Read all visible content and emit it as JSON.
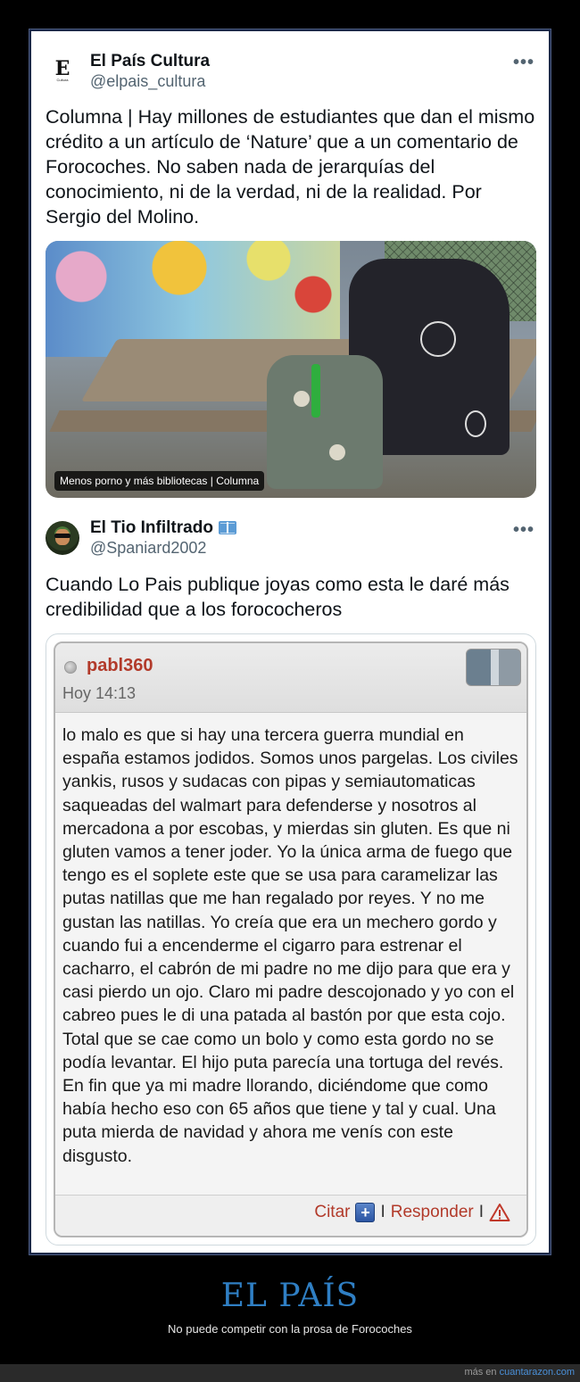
{
  "tweet1": {
    "name": "El País Cultura",
    "handle": "@elpais_cultura",
    "avatar_letter": "E",
    "avatar_sub": "Cultura",
    "more": "•••",
    "text": "Columna | Hay millones de estudiantes que dan el mismo crédito a un artículo de ‘Nature’ que a un comentario de Forocoches. No saben nada de jerarquías del conocimiento, ni de la verdad, ni de la realidad. Por Sergio del Molino.",
    "card_caption": "Menos porno y más bibliotecas | Columna"
  },
  "tweet2": {
    "name": "El Tio Infiltrado",
    "handle": "@Spaniard2002",
    "more": "•••",
    "badge_icon": "book-icon",
    "text": "Cuando Lo Pais publique joyas como esta le daré más credibilidad que a los forococheros"
  },
  "forum_post": {
    "user": "pabl360",
    "time": "Hoy 14:13",
    "body": "lo malo es que si hay una tercera guerra mundial en españa estamos jodidos. Somos unos pargelas. Los civiles yankis, rusos y sudacas con pipas y semiautomaticas saqueadas del walmart para defenderse y nosotros al mercadona a por escobas, y mierdas sin gluten. Es que ni gluten vamos a tener joder. Yo la única arma de fuego que tengo es el soplete este que se usa para caramelizar las putas natillas que me han regalado por reyes. Y no me gustan las natillas. Yo creía que era un mechero gordo y cuando fui a encenderme el cigarro para estrenar el cacharro, el cabrón de mi padre no me dijo para que era y casi pierdo un ojo. Claro mi padre descojonado y yo con el cabreo pues le di una patada al bastón por que esta cojo. Total que se cae como un bolo y como esta gordo no se podía levantar. El hijo puta parecía una tortuga del revés. En fin que ya mi madre llorando, diciéndome que como había hecho eso con 65 años que tiene y tal y cual. Una puta mierda de navidad y ahora me venís con este disgusto.",
    "quote_label": "Citar",
    "separator": "I",
    "reply_label": "Responder",
    "accent_color": "#b23a2a"
  },
  "footer": {
    "headline": "EL PAÍS",
    "subline": "No puede competir con la prosa de Forocoches",
    "more_prefix": "más en",
    "more_link": "cuantarazon.com"
  }
}
